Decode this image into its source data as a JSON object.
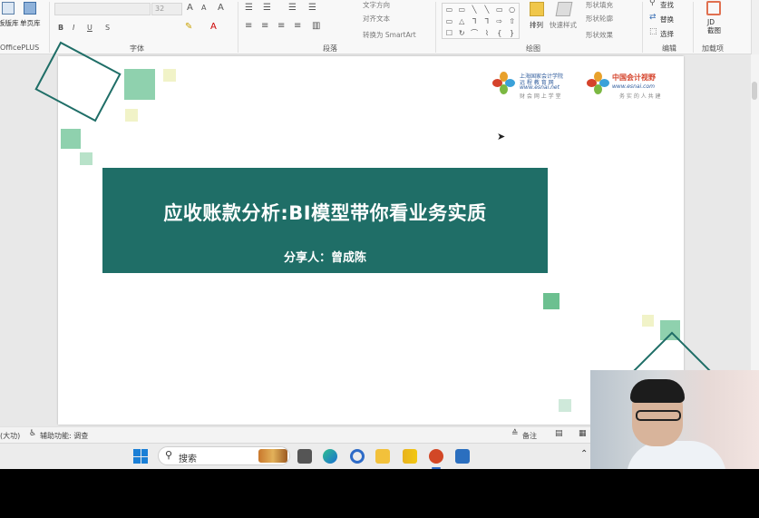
{
  "ribbon": {
    "left_buttons": [
      "板版库",
      "单页库"
    ],
    "addin_label": "OfficePLUS",
    "font_size": "32",
    "groups": {
      "font": "字体",
      "paragraph": "段落",
      "drawing": "绘图",
      "editing": "编辑",
      "addins": "加载项"
    },
    "paragraph_items": [
      "文字方向",
      "对齐文本",
      "转换为 SmartArt"
    ],
    "arrange_label": "排列",
    "quick_styles_label": "快速样式",
    "shape_items": [
      "形状填充",
      "形状轮廓",
      "形状效果"
    ],
    "editing_items": [
      "查找",
      "替换",
      "选择"
    ],
    "addin_button": "JD\n截图"
  },
  "slide": {
    "title": "应收账款分析:BI模型带你看业务实质",
    "presenter": "分享人：曾成陈",
    "logo1": {
      "line1": "上海国家会计学院",
      "line2": "远 程 教 育 网",
      "line3": "www.esnai.net",
      "line4": "财 会 网 上 学 堂"
    },
    "logo2": {
      "line1": "中国会计视野",
      "line2": "www.esnai.com",
      "line3": "务 实 的 人 共 建"
    },
    "colors": {
      "primary": "#1f6e67",
      "accent_green": "#8fd1ae",
      "accent_yellow": "#f1f3c8"
    }
  },
  "statusbar": {
    "left": "(大功)",
    "accessibility": "辅助功能: 调查",
    "notes": "备注"
  },
  "taskbar": {
    "search_placeholder": "搜索"
  }
}
